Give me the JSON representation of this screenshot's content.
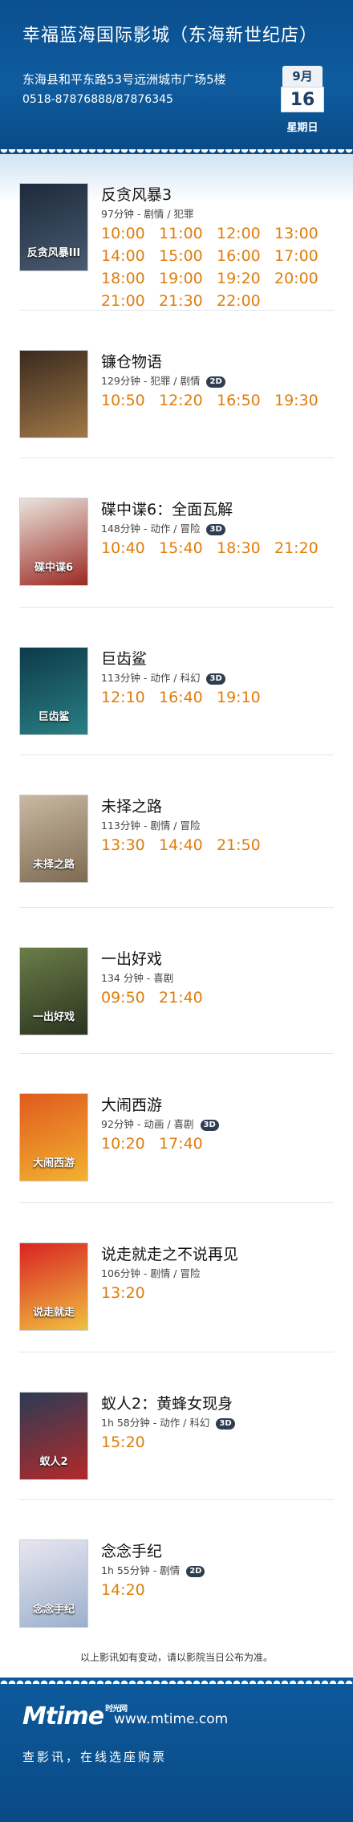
{
  "header": {
    "title": "幸福蓝海国际影城（东海新世纪店）",
    "address": "东海县和平东路53号远洲城市广场5楼",
    "phone": "0518-87876888/87876345",
    "date": {
      "month": "9月",
      "day": "16",
      "weekday": "星期日"
    }
  },
  "movies": [
    {
      "title": "反贪风暴3",
      "meta": "97分钟 - 剧情 / 犯罪",
      "format": "",
      "poster_text": "反贪风暴III",
      "poster_colors": [
        "#1d2a3c",
        "#4a5a70"
      ],
      "times": [
        "10:00",
        "11:00",
        "12:00",
        "13:00",
        "14:00",
        "15:00",
        "16:00",
        "17:00",
        "18:00",
        "19:00",
        "19:20",
        "20:00",
        "21:00",
        "21:30",
        "22:00"
      ]
    },
    {
      "title": "镰仓物语",
      "meta": "129分钟 - 犯罪 / 剧情",
      "format": "2D",
      "poster_text": "",
      "poster_colors": [
        "#3a2a1e",
        "#a07848"
      ],
      "times": [
        "10:50",
        "12:20",
        "16:50",
        "19:30"
      ]
    },
    {
      "title": "碟中谍6：全面瓦解",
      "meta": "148分钟 - 动作 / 冒险",
      "format": "3D",
      "poster_text": "碟中谍6",
      "poster_colors": [
        "#e9e4dd",
        "#9b2a22"
      ],
      "times": [
        "10:40",
        "15:40",
        "18:30",
        "21:20"
      ]
    },
    {
      "title": "巨齿鲨",
      "meta": "113分钟 - 动作 / 科幻",
      "format": "3D",
      "poster_text": "巨齿鲨",
      "poster_colors": [
        "#0d3a4a",
        "#2a7f84"
      ],
      "times": [
        "12:10",
        "16:40",
        "19:10"
      ]
    },
    {
      "title": "未择之路",
      "meta": "113分钟 - 剧情 / 冒险",
      "format": "",
      "poster_text": "未择之路",
      "poster_colors": [
        "#c9b9a3",
        "#7e6a52"
      ],
      "times": [
        "13:30",
        "14:40",
        "21:50"
      ]
    },
    {
      "title": "一出好戏",
      "meta": "134 分钟 - 喜剧",
      "format": "",
      "poster_text": "一出好戏",
      "poster_colors": [
        "#6b7d48",
        "#2b3420"
      ],
      "times": [
        "09:50",
        "21:40"
      ]
    },
    {
      "title": "大闹西游",
      "meta": "92分钟 - 动画 / 喜剧",
      "format": "3D",
      "poster_text": "大闹西游",
      "poster_colors": [
        "#e05a1e",
        "#f2b230"
      ],
      "times": [
        "10:20",
        "17:40"
      ]
    },
    {
      "title": "说走就走之不说再见",
      "meta": "106分钟 - 剧情 / 冒险",
      "format": "",
      "poster_text": "说走就走",
      "poster_colors": [
        "#d92323",
        "#f0c040"
      ],
      "times": [
        "13:20"
      ]
    },
    {
      "title": "蚁人2：黄蜂女现身",
      "meta": "1h 58分钟 - 动作 / 科幻",
      "format": "3D",
      "poster_text": "蚁人2",
      "poster_colors": [
        "#2b3b55",
        "#b22a2a"
      ],
      "times": [
        "15:20"
      ]
    },
    {
      "title": "念念手纪",
      "meta": "1h 55分钟 - 剧情",
      "format": "2D",
      "poster_text": "念念手纪",
      "poster_colors": [
        "#e9e6f0",
        "#9bb0cc"
      ],
      "times": [
        "14:20"
      ]
    }
  ],
  "notice": "以上影讯如有变动，请以影院当日公布为准。",
  "footer": {
    "logo": "Mtime",
    "logo_cn": "时光网",
    "site": "www.mtime.com",
    "slogan": "查影讯，在线选座购票"
  },
  "colors": {
    "header_bg": "#0e5c9f",
    "showtime": "#e07d0b"
  }
}
